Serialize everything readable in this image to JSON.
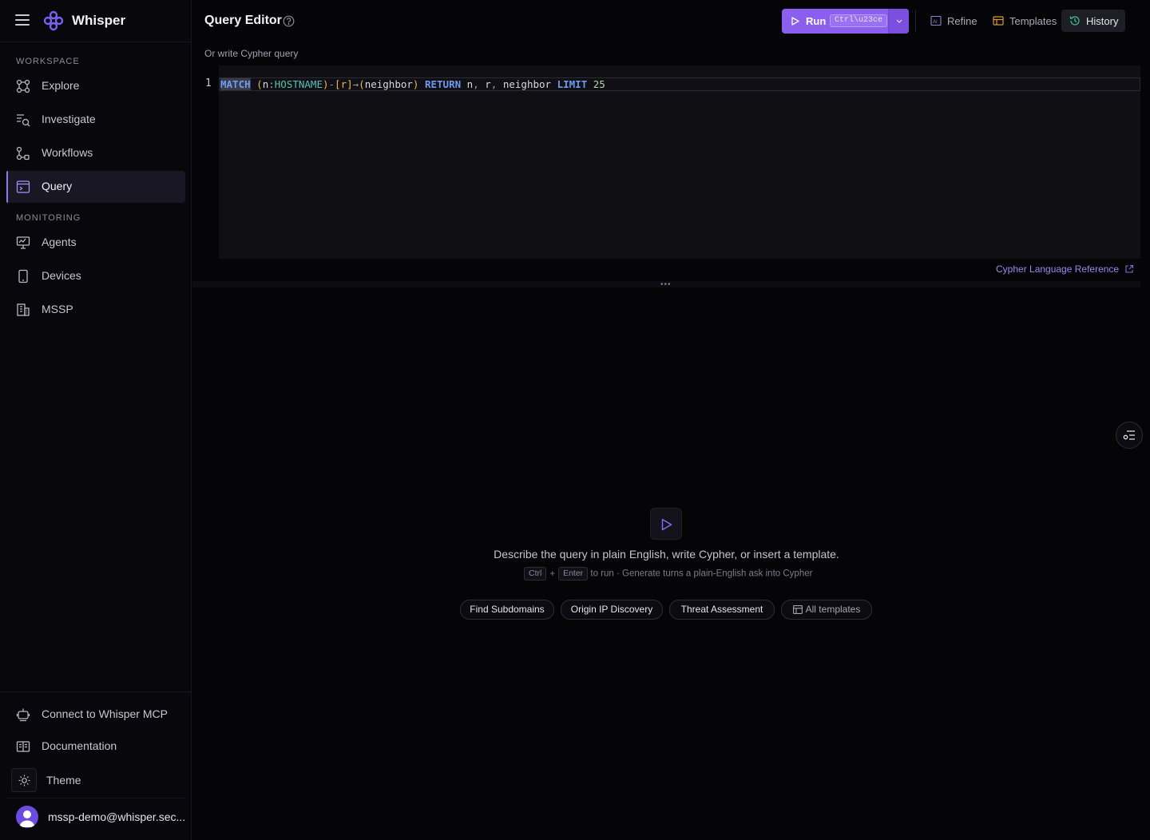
{
  "app": {
    "name": "Whisper"
  },
  "sidebar": {
    "sections": [
      {
        "label": "WORKSPACE"
      },
      {
        "label": "MONITORING"
      }
    ],
    "items": [
      {
        "label": "Explore",
        "icon": "nodes-icon"
      },
      {
        "label": "Investigate",
        "icon": "search-list-icon"
      },
      {
        "label": "Workflows",
        "icon": "workflow-icon"
      },
      {
        "label": "Query",
        "icon": "query-terminal-icon",
        "active": true
      },
      {
        "label": "Agents",
        "icon": "agent-monitor-icon"
      },
      {
        "label": "Devices",
        "icon": "device-icon"
      },
      {
        "label": "MSSP",
        "icon": "building-icon"
      }
    ],
    "footer": {
      "mcp_label": "Connect to Whisper MCP",
      "docs_label": "Documentation",
      "theme_label": "Theme",
      "user_email": "mssp-demo@whisper.sec..."
    }
  },
  "header": {
    "title": "Query Editor",
    "run": {
      "label": "Run",
      "shortcut": "Ctrl\\u23ce"
    },
    "tools": [
      {
        "label": "Refine",
        "icon": "ai-refine-icon"
      },
      {
        "label": "Templates",
        "icon": "templates-icon"
      },
      {
        "label": "History",
        "icon": "history-icon",
        "active": true
      }
    ]
  },
  "editor": {
    "label": "Or write Cypher query",
    "line_number": "1",
    "query": "MATCH (n:HOSTNAME)-[r]→(neighbor) RETURN n, r, neighbor LIMIT 25",
    "tokens": {
      "match": "MATCH",
      "open1": "(",
      "n": "n",
      "colon": ":",
      "label": "HOSTNAME",
      "close1": ")",
      "dash": "-",
      "rel": "[r]",
      "arrow": "→",
      "open2": "(",
      "neighbor": "neighbor",
      "close2": ")",
      "return": "RETURN",
      "ret_n": "n",
      "comma1": ",",
      "ret_r": "r",
      "comma2": ",",
      "ret_neighbor": "neighbor",
      "limit": "LIMIT",
      "limit_value": "25"
    },
    "reference_link": "Cypher Language Reference"
  },
  "empty_state": {
    "title": "Describe the query in plain English, write Cypher, or insert a template.",
    "hint_key1": "Ctrl",
    "hint_plus": "+",
    "hint_key2": "Enter",
    "hint_text": "to run · Generate turns a plain-English ask into Cypher",
    "templates": [
      "Find Subdomains",
      "Origin IP Discovery",
      "Threat Assessment"
    ],
    "all_templates_label": "All templates"
  },
  "colors": {
    "accent": "#8c5ef0",
    "keyword": "#6b9cf2",
    "label": "#4fc3b5",
    "bracket": "#f2b84b"
  }
}
